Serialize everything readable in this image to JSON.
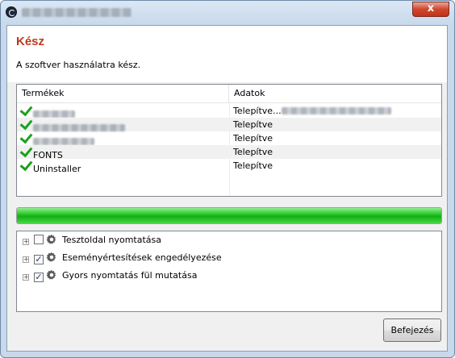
{
  "window": {
    "close_glyph": "x"
  },
  "header": {
    "title": "Kész",
    "subtitle": "A szoftver használatra kész."
  },
  "products": {
    "columns": [
      "Termékek",
      "Adatok"
    ],
    "rows": [
      {
        "name": "",
        "status": "Telepítve..."
      },
      {
        "name": "",
        "status": "Telepítve"
      },
      {
        "name": "",
        "status": "Telepítve"
      },
      {
        "name": "FONTS",
        "status": "Telepítve"
      },
      {
        "name": "Uninstaller",
        "status": "Telepítve"
      }
    ]
  },
  "progress": {
    "fraction": 1.0,
    "color": "#21c021"
  },
  "options": [
    {
      "label": "Tesztoldal nyomtatása",
      "checked": false,
      "icon": "gear-icon"
    },
    {
      "label": "Eseményértesítések engedélyezése",
      "checked": true,
      "icon": "gear-icon"
    },
    {
      "label": "Gyors nyomtatás fül mutatása",
      "checked": true,
      "icon": "gear-icon"
    }
  ],
  "footer": {
    "finish_label": "Befejezés"
  },
  "colors": {
    "heading": "#c0391b",
    "check": "#1aa21a",
    "close": "#d0462f"
  }
}
